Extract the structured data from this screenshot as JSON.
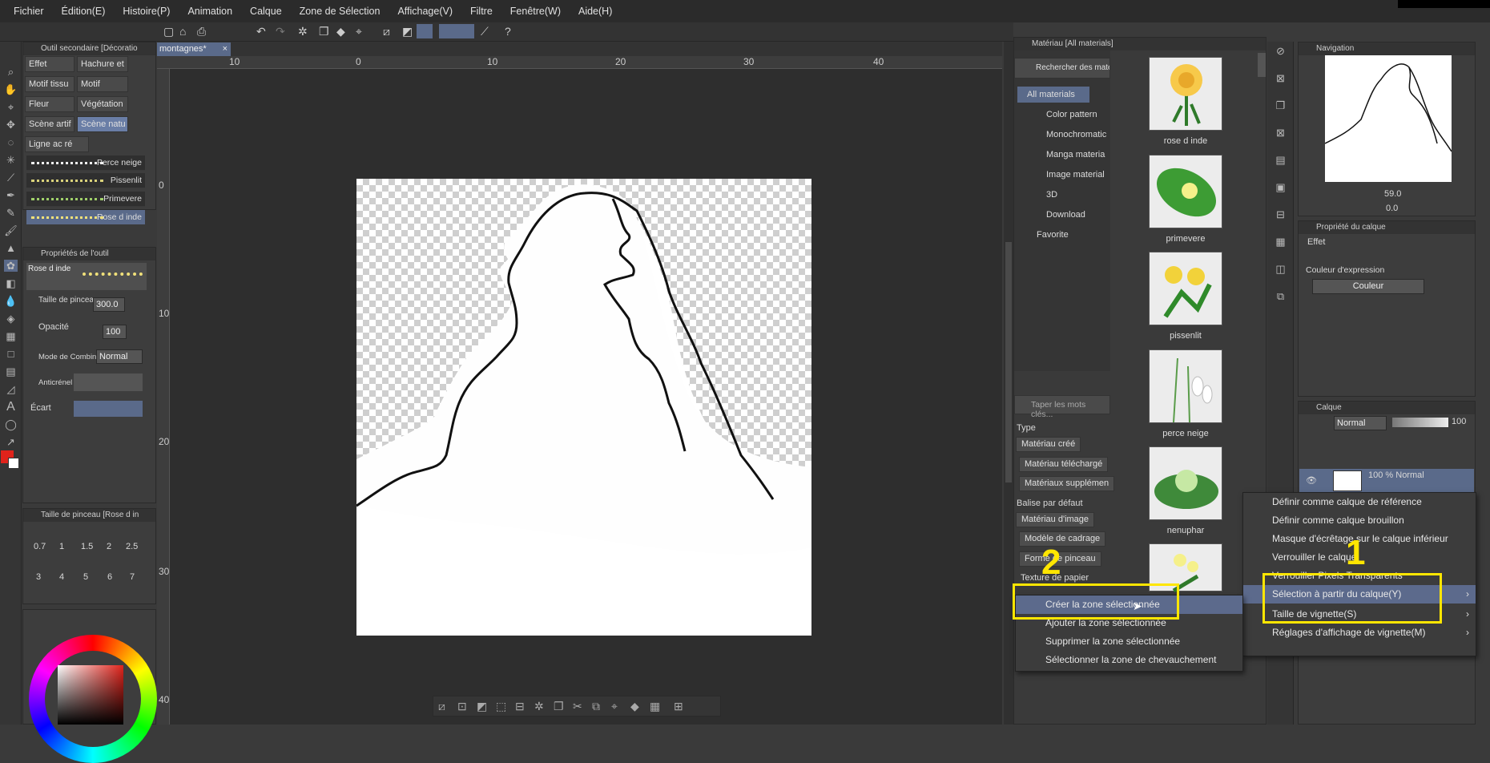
{
  "menubar": {
    "items": [
      "Fichier",
      "Édition(E)",
      "Histoire(P)",
      "Animation",
      "Calque",
      "Zone de Sélection",
      "Affichage(V)",
      "Filtre",
      "Fenêtre(W)",
      "Aide(H)"
    ]
  },
  "canvas_tab": {
    "label": "montagnes*"
  },
  "sub_tool_panel": {
    "title": "Outil secondaire [Décoratio",
    "buttons": [
      "Effet",
      "Hachure et",
      "Motif tissu",
      "Motif",
      "Fleur",
      "Végétation",
      "Scène artif",
      "Scène natu",
      "Ligne ac ré"
    ],
    "brushes": [
      "Perce neige",
      "Pissenlit",
      "Primevere",
      "Rose d inde"
    ]
  },
  "tool_property": {
    "title": "Propriétés de l'outil",
    "preview_label": "Rose d inde",
    "brush_size_label": "Taille de pinceau",
    "brush_size_value": "300.0",
    "opacity_label": "Opacité",
    "opacity_value": "100",
    "blend_label": "Mode de Combinais",
    "blend_value": "Normal",
    "antialias_label": "Anticrénel",
    "spacing_label": "Écart"
  },
  "brush_size_panel": {
    "title": "Taille de pinceau [Rose d in",
    "sizes": [
      "0.7",
      "1",
      "1.5",
      "2",
      "2.5",
      "3",
      "4",
      "5",
      "6",
      "7"
    ]
  },
  "ruler": {
    "h": [
      "10",
      "0",
      "10",
      "20",
      "30",
      "40"
    ],
    "v": [
      "0",
      "10",
      "20",
      "30",
      "40"
    ]
  },
  "material_panel": {
    "title": "Matériau [All materials]",
    "search_button": "Rechercher des matériau",
    "tree": [
      "All materials",
      "Color pattern",
      "Monochromatic",
      "Manga materia",
      "Image material",
      "3D",
      "Download",
      "Favorite"
    ],
    "search_placeholder": "Taper les mots clés...",
    "type_label": "Type",
    "type_tags": [
      "Matériau créé",
      "Matériau téléchargé",
      "Matériaux supplémen"
    ],
    "default_tag_label": "Balise par défaut",
    "default_tags": [
      "Matériau d'image",
      "Modèle de cadrage",
      "Forme de pinceau",
      "Texture de papier"
    ],
    "thumbnails": [
      "rose d inde",
      "primevere",
      "pissenlit",
      "perce neige",
      "nenuphar"
    ]
  },
  "navigation": {
    "title": "Navigation",
    "zoom": "59.0",
    "rotation": "0.0"
  },
  "layer_property": {
    "title": "Propriété du calque",
    "effect_label": "Effet",
    "expr_color_label": "Couleur d'expression",
    "expr_color_value": "Couleur"
  },
  "layer_panel": {
    "title": "Calque",
    "blend": "Normal",
    "opacity": "100",
    "layer_info": "100 % Normal"
  },
  "context_menu_right": {
    "items": [
      "Définir comme calque de référence",
      "Définir comme calque brouillon",
      "Masque d'écrêtage sur le calque inférieur",
      "Verrouiller le calque",
      "Verrouiller Pixels Transparents",
      "Sélection à partir du calque(Y)",
      "Taille de vignette(S)",
      "Réglages d'affichage de vignette(M)"
    ],
    "highlighted": "Sélection à partir du calque(Y)"
  },
  "context_submenu": {
    "items": [
      "Créer la zone sélectionnée",
      "Ajouter la zone sélectionnée",
      "Supprimer la zone sélectionnée",
      "Sélectionner la zone de chevauchement"
    ],
    "highlighted": "Créer la zone sélectionnée"
  },
  "annotations": {
    "step1": "1",
    "step2": "2"
  },
  "colors": {
    "accent_highlight": "#5c6a8c",
    "annotation_yellow": "#ffe600",
    "main_color": "#e0231b"
  }
}
